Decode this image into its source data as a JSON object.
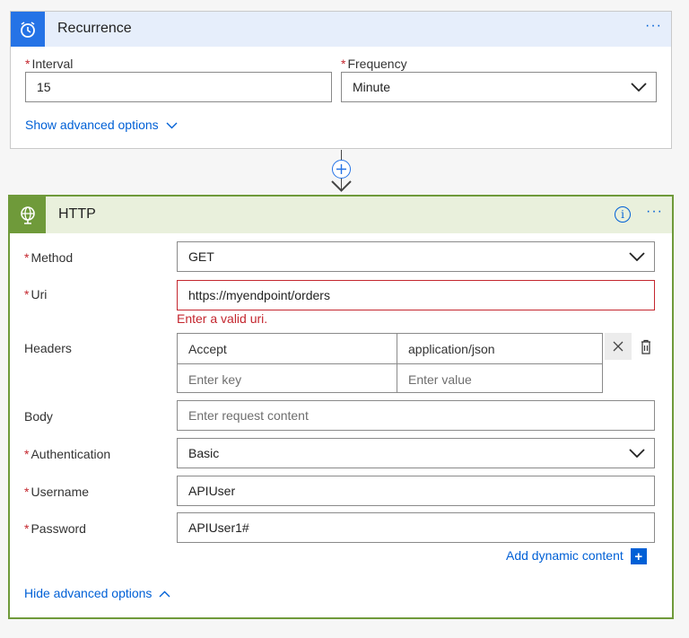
{
  "recurrence": {
    "title": "Recurrence",
    "more_label": "···",
    "interval_label": "Interval",
    "interval_value": "15",
    "frequency_label": "Frequency",
    "frequency_value": "Minute",
    "show_advanced": "Show advanced options",
    "required_mark": "*",
    "icon": "alarm-clock-icon",
    "accent": "#2573e6"
  },
  "connector": {
    "icon": "add-step-plus-icon"
  },
  "http": {
    "title": "HTTP",
    "info_label": "i",
    "more_label": "···",
    "icon": "globe-icon",
    "accent": "#6f9a3a",
    "method_label": "Method",
    "method_value": "GET",
    "uri_label": "Uri",
    "uri_value": "https://myendpoint/orders",
    "uri_error": "Enter a valid uri.",
    "headers_label": "Headers",
    "headers": [
      {
        "key": "Accept",
        "value": "application/json"
      }
    ],
    "header_key_placeholder": "Enter key",
    "header_value_placeholder": "Enter value",
    "body_label": "Body",
    "body_placeholder": "Enter request content",
    "auth_label": "Authentication",
    "auth_value": "Basic",
    "username_label": "Username",
    "username_value": "APIUser",
    "password_label": "Password",
    "password_value": "APIUser1#",
    "add_dynamic": "Add dynamic content",
    "add_dynamic_plus": "+",
    "hide_advanced": "Hide advanced options",
    "required_mark": "*",
    "error_color": "#c4262e"
  }
}
